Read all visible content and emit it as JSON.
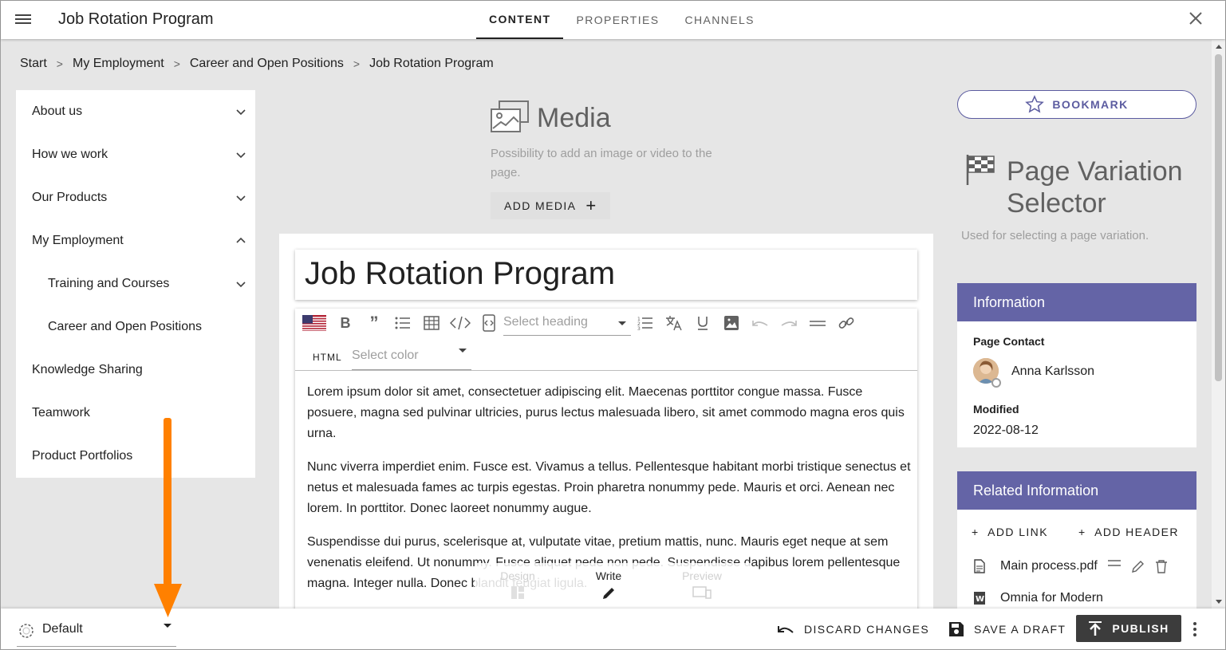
{
  "header": {
    "app_title": "Job Rotation Program",
    "tabs": [
      {
        "label": "CONTENT",
        "active": true
      },
      {
        "label": "PROPERTIES",
        "active": false
      },
      {
        "label": "CHANNELS",
        "active": false
      }
    ],
    "icons": {
      "menu": "hamburger-menu-icon",
      "close": "close-icon"
    }
  },
  "breadcrumb": {
    "items": [
      "Start",
      "My Employment",
      "Career and Open Positions",
      "Job Rotation Program"
    ],
    "separator": ">"
  },
  "sidebar": {
    "items": [
      {
        "label": "About us",
        "expanded": false,
        "has_children": true
      },
      {
        "label": "How we work",
        "expanded": false,
        "has_children": true
      },
      {
        "label": "Our Products",
        "expanded": false,
        "has_children": true
      },
      {
        "label": "My Employment",
        "expanded": true,
        "has_children": true
      },
      {
        "label": "Training and Courses",
        "expanded": false,
        "has_children": true
      },
      {
        "label": "Career and Open Positions",
        "expanded": false,
        "has_children": false
      },
      {
        "label": "Knowledge Sharing",
        "expanded": false,
        "has_children": false
      },
      {
        "label": "Teamwork",
        "expanded": false,
        "has_children": false
      },
      {
        "label": "Product Portfolios",
        "expanded": false,
        "has_children": false
      }
    ]
  },
  "media": {
    "title": "Media",
    "description": "Possibility to add an image or video to the page.",
    "add_button": "ADD MEDIA"
  },
  "editor": {
    "page_title": "Job Rotation Program",
    "heading_placeholder": "Select heading",
    "color_placeholder": "Select color",
    "html_label": "HTML",
    "paragraphs": [
      "Lorem ipsum dolor sit amet, consectetuer adipiscing elit. Maecenas porttitor congue massa. Fusce posuere, magna sed pulvinar ultricies, purus lectus malesuada libero, sit amet commodo magna eros quis urna.",
      "Nunc viverra imperdiet enim. Fusce est. Vivamus a tellus. Pellentesque habitant morbi tristique senectus et netus et malesuada fames ac turpis egestas. Proin pharetra nonummy pede. Mauris et orci. Aenean nec lorem. In porttitor. Donec laoreet nonummy augue.",
      "Suspendisse dui purus, scelerisque at, vulputate vitae, pretium mattis, nunc. Mauris eget neque at sem venenatis eleifend. Ut nonummy. Fusce aliquet pede non pede. Suspendisse dapibus lorem pellentesque magna. Integer nulla. Donec blandit feugiat ligula."
    ]
  },
  "mode_switch": {
    "design": "Design",
    "write": "Write",
    "preview": "Preview"
  },
  "right_panel": {
    "bookmark_label": "BOOKMARK",
    "page_variation": {
      "title": "Page Variation Selector",
      "description": "Used for selecting a page variation."
    },
    "information": {
      "header": "Information",
      "page_contact_label": "Page Contact",
      "contact_name": "Anna Karlsson",
      "modified_label": "Modified",
      "modified_value": "2022-08-12"
    },
    "related": {
      "header": "Related Information",
      "add_link": "ADD LINK",
      "add_header": "ADD HEADER",
      "items": [
        "Main process.pdf",
        "Omnia for Modern"
      ]
    }
  },
  "bottom_bar": {
    "variation_value": "Default",
    "discard_label": "DISCARD CHANGES",
    "save_draft_label": "SAVE A DRAFT",
    "publish_label": "PUBLISH"
  },
  "colors": {
    "accent_purple": "#6464a6",
    "publish_bg": "#3c3c3c",
    "annotation_arrow": "#ff8000"
  }
}
